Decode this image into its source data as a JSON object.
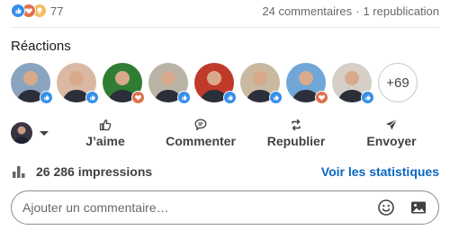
{
  "stats": {
    "reactions_count": "77",
    "comments": "24 commentaires",
    "separator": "·",
    "reposts": "1 republication"
  },
  "reactions_section": {
    "title": "Réactions",
    "more_count": "+69",
    "avatars": [
      {
        "badge": "like",
        "bg": "#8aa4bf"
      },
      {
        "badge": "like",
        "bg": "#d9b9a3"
      },
      {
        "badge": "love",
        "bg": "#2f7d32"
      },
      {
        "badge": "like",
        "bg": "#b9b4a6"
      },
      {
        "badge": "like",
        "bg": "#c0392b"
      },
      {
        "badge": "like",
        "bg": "#c8b9a0"
      },
      {
        "badge": "love",
        "bg": "#6fa7d8"
      },
      {
        "badge": "like",
        "bg": "#d5cfc8"
      }
    ]
  },
  "actions": {
    "like": "J’aime",
    "comment": "Commenter",
    "repost": "Republier",
    "send": "Envoyer"
  },
  "impressions": {
    "text": "26 286 impressions",
    "link": "Voir les statistiques"
  },
  "comment_box": {
    "placeholder": "Ajouter un commentaire…"
  },
  "colors": {
    "like": "#378fe9",
    "love": "#df704d",
    "insight": "#f5bb5c",
    "link": "#0a66c2"
  }
}
